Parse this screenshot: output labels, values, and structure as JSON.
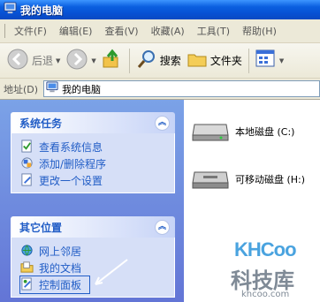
{
  "window": {
    "title": "我的电脑"
  },
  "menu": [
    "文件(F)",
    "编辑(E)",
    "查看(V)",
    "收藏(A)",
    "工具(T)",
    "帮助(H)"
  ],
  "toolbar": {
    "back_label": "后退",
    "search_label": "搜索",
    "folders_label": "文件夹"
  },
  "address": {
    "label": "地址(D)",
    "value": "我的电脑"
  },
  "tasks_panel": {
    "title": "系统任务",
    "items": [
      "查看系统信息",
      "添加/删除程序",
      "更改一个设置"
    ]
  },
  "places_panel": {
    "title": "其它位置",
    "items": [
      "网上邻居",
      "我的文档",
      "控制面板"
    ]
  },
  "drives": [
    "本地磁盘 (C:)",
    "可移动磁盘 (H:)"
  ],
  "watermark": {
    "logo": "KHCoo",
    "name": "科技库",
    "url": "khcoo.com"
  },
  "colors": {
    "titlebar": "#0a5fe0",
    "task_pane": "#6375d6",
    "link": "#215dc6"
  },
  "icons": [
    "computer-icon",
    "back-arrow-icon",
    "forward-arrow-icon",
    "up-folder-icon",
    "search-icon",
    "folders-icon",
    "views-icon",
    "collapse-icon",
    "system-info-icon",
    "add-remove-icon",
    "settings-icon",
    "network-icon",
    "documents-icon",
    "control-panel-icon",
    "hard-drive-icon",
    "removable-drive-icon"
  ]
}
